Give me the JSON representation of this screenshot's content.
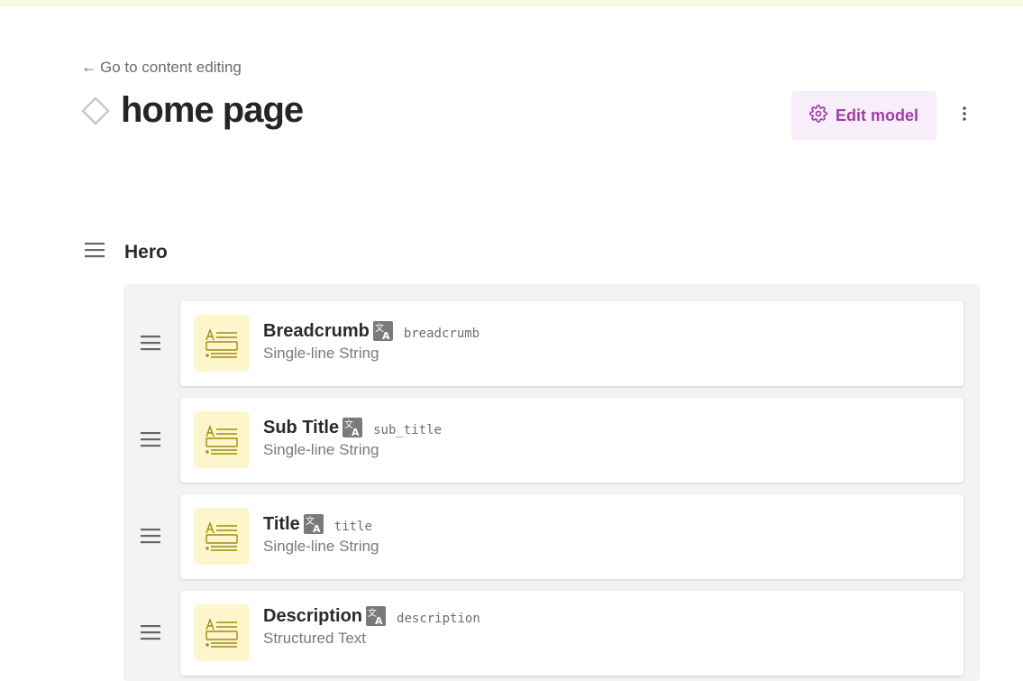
{
  "nav": {
    "back_label": "Go to content editing"
  },
  "header": {
    "title": "home page",
    "edit_model_label": "Edit model"
  },
  "section": {
    "title": "Hero"
  },
  "fields": [
    {
      "name": "Breadcrumb",
      "api_key": "breadcrumb",
      "type": "Single-line String"
    },
    {
      "name": "Sub Title",
      "api_key": "sub_title",
      "type": "Single-line String"
    },
    {
      "name": "Title",
      "api_key": "title",
      "type": "Single-line String"
    },
    {
      "name": "Description",
      "api_key": "description",
      "type": "Structured Text"
    }
  ],
  "colors": {
    "accent": "#a03ea6",
    "edit_button_bg": "#f7eef9",
    "field_icon_bg": "#fdf6cc",
    "field_icon_stroke": "#a08a10",
    "panel_bg": "#f3f3f3"
  },
  "icons": {
    "back": "left-arrow-icon",
    "model": "diamond-icon",
    "edit": "gear-icon",
    "more": "vertical-dots-icon",
    "drag": "drag-handle-icon",
    "field": "text-field-icon",
    "localized": "translate-icon"
  }
}
